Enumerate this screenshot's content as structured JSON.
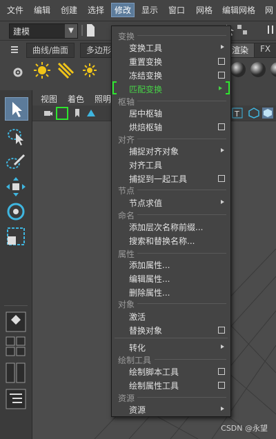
{
  "menubar": [
    "文件",
    "编辑",
    "创建",
    "选择",
    "修改",
    "显示",
    "窗口",
    "网格",
    "编辑网格",
    "网"
  ],
  "status": {
    "mode": "建模"
  },
  "shelf": {
    "tabs": [
      "曲线/曲面",
      "多边形",
      "渲染",
      "FX"
    ]
  },
  "viewport": {
    "menu": [
      "视图",
      "着色",
      "照明"
    ]
  },
  "dropdown": {
    "sections": {
      "transform": "变换",
      "pivot": "枢轴",
      "align": "对齐",
      "node": "节点",
      "naming": "命名",
      "attributes": "属性",
      "objects": "对象",
      "paint": "绘制工具",
      "assets": "资源"
    },
    "items": {
      "transform_tool": "变换工具",
      "reset_transform": "重置变换",
      "freeze_transform": "冻结变换",
      "match_transform": "匹配变换",
      "center_pivot": "居中枢轴",
      "bake_pivot": "烘焙枢轴",
      "snap_align": "捕捉对齐对象",
      "align_tool": "对齐工具",
      "snap_together": "捕捉到一起工具",
      "node_eval": "节点求值",
      "add_prefix": "添加层次名称前缀...",
      "search_replace": "搜索和替换名称...",
      "add_attr": "添加属性...",
      "edit_attr": "编辑属性...",
      "delete_attr": "删除属性...",
      "activate": "激活",
      "replace_obj": "替换对象",
      "convert": "转化",
      "paint_script": "绘制脚本工具",
      "paint_attr": "绘制属性工具",
      "assets": "资源"
    }
  },
  "watermark": "CSDN @永望",
  "colors": {
    "highlight": "#47d147",
    "active_menu": "#5c7b9a"
  }
}
